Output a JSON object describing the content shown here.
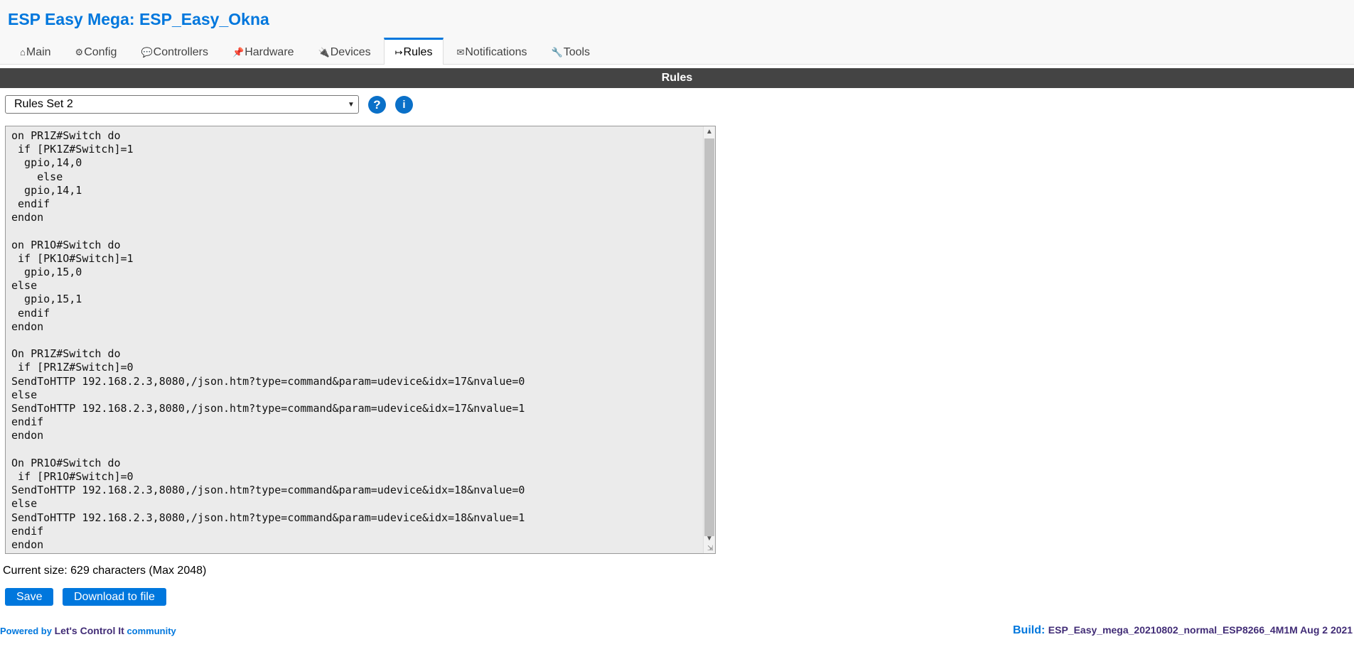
{
  "app": {
    "title": "ESP Easy Mega: ESP_Easy_Okna"
  },
  "tabs": [
    {
      "icon": "⌂",
      "label": "Main"
    },
    {
      "icon": "⚙",
      "label": "Config"
    },
    {
      "icon": "💬",
      "label": "Controllers"
    },
    {
      "icon": "📌",
      "label": "Hardware"
    },
    {
      "icon": "🔌",
      "label": "Devices"
    },
    {
      "icon": "↦",
      "label": "Rules"
    },
    {
      "icon": "✉",
      "label": "Notifications"
    },
    {
      "icon": "🔧",
      "label": "Tools"
    }
  ],
  "active_tab": "Rules",
  "section": {
    "title": "Rules"
  },
  "rules_select": {
    "value": "Rules Set 2"
  },
  "help_buttons": {
    "help_label": "?",
    "info_label": "i"
  },
  "editor": {
    "content": "on PR1Z#Switch do\n if [PK1Z#Switch]=1\n  gpio,14,0\n    else\n  gpio,14,1\n endif\nendon\n\non PR1O#Switch do\n if [PK1O#Switch]=1\n  gpio,15,0\nelse\n  gpio,15,1\n endif\nendon\n\nOn PR1Z#Switch do\n if [PR1Z#Switch]=0\nSendToHTTP 192.168.2.3,8080,/json.htm?type=command&param=udevice&idx=17&nvalue=0\nelse\nSendToHTTP 192.168.2.3,8080,/json.htm?type=command&param=udevice&idx=17&nvalue=1\nendif\nendon\n\nOn PR1O#Switch do\n if [PR1O#Switch]=0\nSendToHTTP 192.168.2.3,8080,/json.htm?type=command&param=udevice&idx=18&nvalue=0\nelse\nSendToHTTP 192.168.2.3,8080,/json.htm?type=command&param=udevice&idx=18&nvalue=1\nendif\nendon"
  },
  "size_info": "Current size: 629 characters (Max 2048)",
  "buttons": {
    "save": "Save",
    "download": "Download to file"
  },
  "footer": {
    "powered_by": "Powered by",
    "brand": "Let's Control It",
    "community": "community",
    "build_label": "Build:",
    "build_value": "ESP_Easy_mega_20210802_normal_ESP8266_4M1M Aug 2 2021"
  },
  "colors": {
    "accent": "#0077dd",
    "section_bar": "#444444",
    "brand_dark": "#412c76"
  }
}
